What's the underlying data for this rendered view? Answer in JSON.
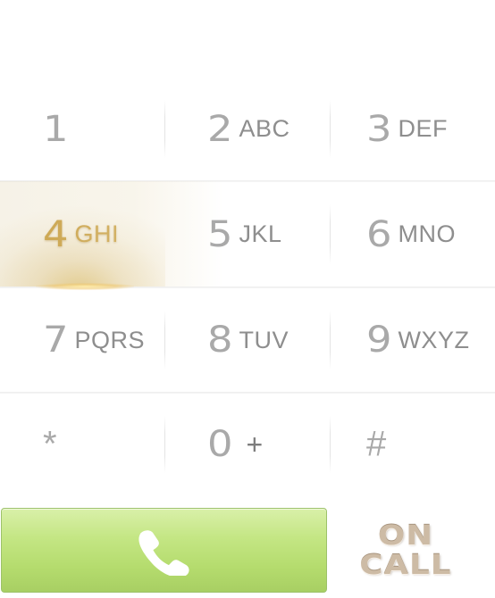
{
  "keypad": {
    "keys": [
      {
        "digit": "1",
        "letters": ""
      },
      {
        "digit": "2",
        "letters": "ABC"
      },
      {
        "digit": "3",
        "letters": "DEF"
      },
      {
        "digit": "4",
        "letters": "GHI"
      },
      {
        "digit": "5",
        "letters": "JKL"
      },
      {
        "digit": "6",
        "letters": "MNO"
      },
      {
        "digit": "7",
        "letters": "PQRS"
      },
      {
        "digit": "8",
        "letters": "TUV"
      },
      {
        "digit": "9",
        "letters": "WXYZ"
      },
      {
        "digit": "*",
        "letters": ""
      },
      {
        "digit": "0",
        "letters": "+"
      },
      {
        "digit": "#",
        "letters": ""
      }
    ],
    "active_key": "4"
  },
  "call_button": {
    "icon": "phone-icon",
    "color": "#b5dc6e"
  },
  "logo": {
    "line1": "ON",
    "line2": "CALL"
  }
}
